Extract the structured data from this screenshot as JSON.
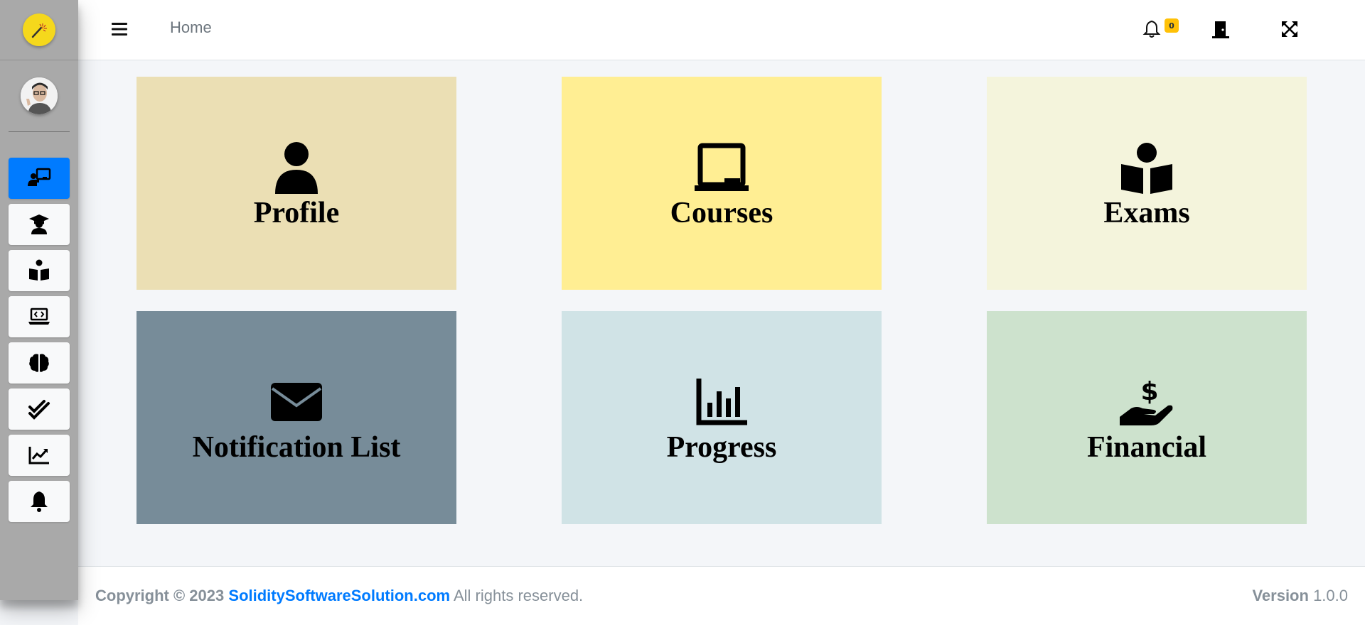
{
  "header": {
    "home_label": "Home",
    "notification_count": "0",
    "icons": [
      "menu-icon",
      "bell-icon",
      "door-exit-icon",
      "fullscreen-icon"
    ]
  },
  "sidebar": {
    "items": [
      {
        "icon": "teacher-board-icon",
        "active": true
      },
      {
        "icon": "graduate-icon",
        "active": false
      },
      {
        "icon": "book-reader-icon",
        "active": false
      },
      {
        "icon": "laptop-code-icon",
        "active": false
      },
      {
        "icon": "brain-icon",
        "active": false
      },
      {
        "icon": "double-check-icon",
        "active": false
      },
      {
        "icon": "chart-line-icon",
        "active": false
      },
      {
        "icon": "bell-icon",
        "active": false
      }
    ]
  },
  "tiles": [
    {
      "label": "Profile",
      "icon": "user-icon",
      "color": "#ebdfb4"
    },
    {
      "label": "Courses",
      "icon": "chalkboard-icon",
      "color": "#ffee93"
    },
    {
      "label": "Exams",
      "icon": "book-reader-icon",
      "color": "#f4f4dc"
    },
    {
      "label": "Notification List",
      "icon": "envelope-icon",
      "color": "#778c99"
    },
    {
      "label": "Progress",
      "icon": "bar-chart-icon",
      "color": "#d0e3e6"
    },
    {
      "label": "Financial",
      "icon": "hand-dollar-icon",
      "color": "#cde2cd"
    }
  ],
  "footer": {
    "copyright_prefix": "Copyright © 2023",
    "site_link": "SoliditySoftwareSolution.com",
    "rights": "All rights reserved.",
    "version_label": "Version",
    "version_value": "1.0.0"
  },
  "colors": {
    "sidebar_bg": "#a9a9a9",
    "active_item": "#007bff",
    "page_bg": "#f4f6f9",
    "link": "#007bff",
    "badge": "#ffc107"
  }
}
